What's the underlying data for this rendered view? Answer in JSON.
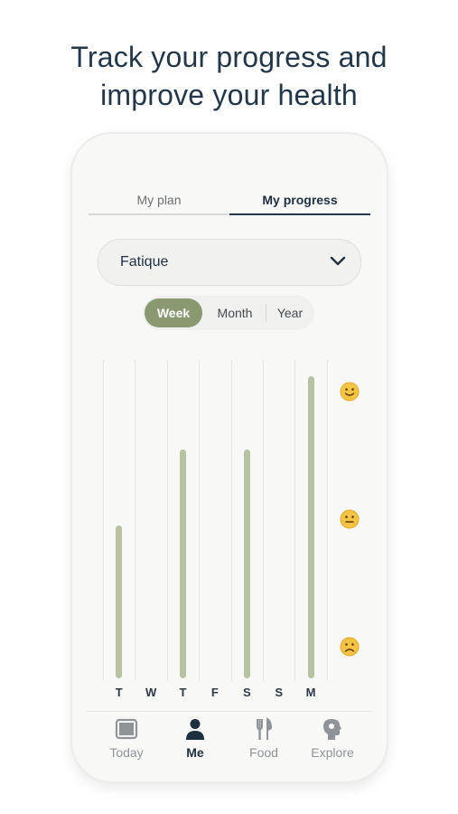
{
  "headline": {
    "line1": "Track your progress and",
    "line2": "improve your health"
  },
  "tabs": [
    {
      "label": "My plan",
      "active": false
    },
    {
      "label": "My progress",
      "active": true
    }
  ],
  "dropdown": {
    "selected": "Fatique",
    "icon": "chevron-down-icon"
  },
  "period": {
    "options": [
      "Week",
      "Month",
      "Year"
    ],
    "selected": "Week"
  },
  "colors": {
    "accent": "#8a9a70",
    "bar": "#b7c2a2",
    "text_dark": "#1e3041"
  },
  "chart_data": {
    "type": "bar",
    "categories": [
      "T",
      "W",
      "T",
      "F",
      "S",
      "S",
      "M"
    ],
    "values": [
      0.48,
      null,
      0.72,
      null,
      0.72,
      null,
      0.95
    ],
    "ylim": [
      0,
      1
    ],
    "y_markers": [
      "slightly-smiling-face-icon",
      "neutral-face-icon",
      "frowning-face-icon"
    ]
  },
  "nav": [
    {
      "label": "Today",
      "icon": "today-image-icon",
      "active": false
    },
    {
      "label": "Me",
      "icon": "person-icon",
      "active": true
    },
    {
      "label": "Food",
      "icon": "fork-knife-icon",
      "active": false
    },
    {
      "label": "Explore",
      "icon": "head-profile-icon",
      "active": false
    }
  ]
}
